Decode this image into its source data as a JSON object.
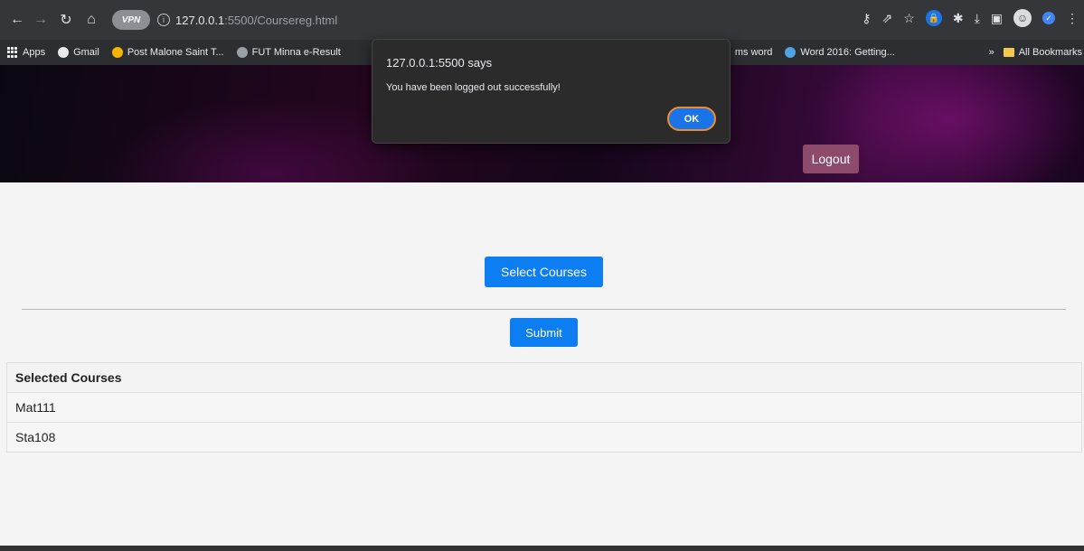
{
  "browser": {
    "vpn_label": "VPN",
    "url_host": "127.0.0.1",
    "url_rest": ":5500/Coursereg.html"
  },
  "bookmarks": {
    "items": [
      {
        "label": "Apps",
        "icon": "apps-grid-icon"
      },
      {
        "label": "Gmail",
        "icon": "google-icon"
      },
      {
        "label": "Post Malone Saint T...",
        "icon": "music-icon"
      },
      {
        "label": "FUT Minna e-Result",
        "icon": "school-icon"
      },
      {
        "label": "ms word",
        "icon": "page-icon"
      },
      {
        "label": "Word 2016: Getting...",
        "icon": "globe-icon"
      }
    ],
    "overflow": "»",
    "all_bookmarks": "All Bookmarks"
  },
  "page": {
    "logout_label": "Logout",
    "select_courses_label": "Select Courses",
    "submit_label": "Submit",
    "table": {
      "header": "Selected Courses",
      "rows": [
        "Mat111",
        "Sta108"
      ]
    }
  },
  "alert": {
    "title": "127.0.0.1:5500 says",
    "message": "You have been logged out successfully!",
    "ok_label": "OK"
  },
  "colors": {
    "primary_button": "#0d7df2",
    "logout_button": "#8e4a6a",
    "alert_background": "#2b2b2c",
    "ok_focus_ring": "#f08c2e"
  }
}
